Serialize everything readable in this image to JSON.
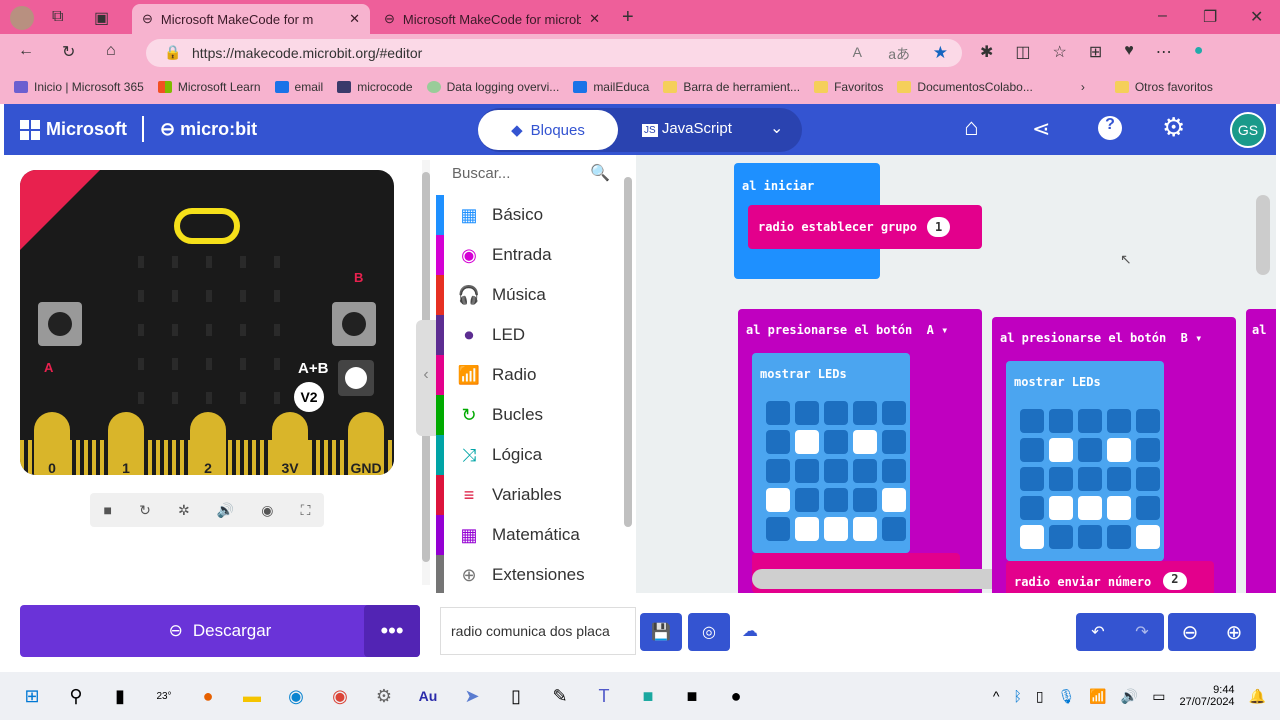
{
  "browser": {
    "tabs": [
      {
        "title": "Microsoft MakeCode for m",
        "active": true
      },
      {
        "title": "Microsoft MakeCode for microbi",
        "active": false
      }
    ],
    "url": "https://makecode.microbit.org/#editor",
    "bookmarks": [
      "Inicio | Microsoft 365",
      "Microsoft Learn",
      "email",
      "microcode",
      "Data logging overvi...",
      "mailEduca",
      "Barra de herramient...",
      "Favoritos",
      "DocumentosColabo..."
    ],
    "other_favorites": "Otros favoritos"
  },
  "header": {
    "brand": "Microsoft",
    "product": "micro:bit",
    "blocks_label": "Bloques",
    "js_label": "JavaScript",
    "avatar": "GS"
  },
  "simulator": {
    "pins": [
      "0",
      "1",
      "2",
      "3V",
      "GND"
    ],
    "ab_label": "A+B",
    "version": "V2",
    "a": "A",
    "b": "B"
  },
  "toolbox": {
    "search_placeholder": "Buscar...",
    "categories": [
      {
        "label": "Básico",
        "color": "#1e90ff",
        "icon": "▦"
      },
      {
        "label": "Entrada",
        "color": "#d400d4",
        "icon": "◉"
      },
      {
        "label": "Música",
        "color": "#e63022",
        "icon": "🎧"
      },
      {
        "label": "LED",
        "color": "#5c2d91",
        "icon": "⏺"
      },
      {
        "label": "Radio",
        "color": "#e3008c",
        "icon": "📶"
      },
      {
        "label": "Bucles",
        "color": "#00aa00",
        "icon": "↻"
      },
      {
        "label": "Lógica",
        "color": "#00a4a6",
        "icon": "⤨"
      },
      {
        "label": "Variables",
        "color": "#dc143c",
        "icon": "≡"
      },
      {
        "label": "Matemática",
        "color": "#9400d3",
        "icon": "▦"
      },
      {
        "label": "Extensiones",
        "color": "#757575",
        "icon": "⊕"
      }
    ]
  },
  "workspace": {
    "on_start": "al iniciar",
    "set_group": "radio establecer grupo",
    "group_value": "1",
    "button_a": {
      "label": "al presionarse el botón",
      "button": "A",
      "show": "mostrar LEDs",
      "leds": [
        0,
        0,
        0,
        0,
        0,
        0,
        1,
        0,
        1,
        0,
        0,
        0,
        0,
        0,
        0,
        1,
        0,
        0,
        0,
        1,
        0,
        1,
        1,
        1,
        0
      ]
    },
    "button_b": {
      "label": "al presionarse el botón",
      "button": "B",
      "show": "mostrar LEDs",
      "leds": [
        0,
        0,
        0,
        0,
        0,
        0,
        1,
        0,
        1,
        0,
        0,
        0,
        0,
        0,
        0,
        0,
        1,
        1,
        1,
        0,
        1,
        0,
        0,
        0,
        1
      ],
      "send": "radio enviar número",
      "send_value": "2"
    },
    "partial": "al"
  },
  "bottom": {
    "download": "Descargar",
    "project_name": "radio comunica dos placa"
  },
  "taskbar": {
    "weather": "23°",
    "time": "9:44",
    "date": "27/07/2024"
  }
}
